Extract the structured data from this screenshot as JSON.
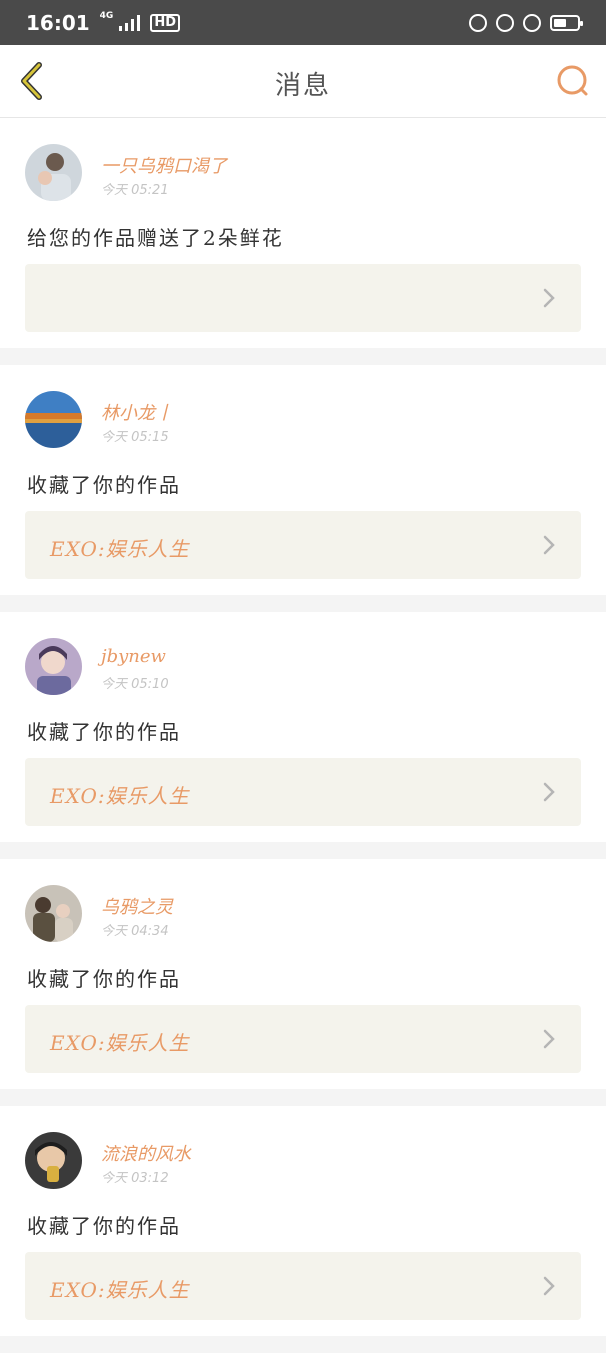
{
  "status_bar": {
    "time": "16:01",
    "network": "4G",
    "hd": "HD"
  },
  "nav": {
    "title": "消息",
    "back_icon": "chevron-left-icon",
    "search_icon": "search-icon",
    "accent": "#e89a66",
    "back_color": "#d6c43a"
  },
  "messages": [
    {
      "user": "一只乌鸦口渴了",
      "time": "今天 05:21",
      "action": "给您的作品赠送了2朵鲜花",
      "work": ""
    },
    {
      "user": "林小龙丨",
      "time": "今天 05:15",
      "action": "收藏了你的作品",
      "work": "EXO:娱乐人生"
    },
    {
      "user": "jbynew",
      "time": "今天 05:10",
      "action": "收藏了你的作品",
      "work": "EXO:娱乐人生"
    },
    {
      "user": "乌鸦之灵",
      "time": "今天 04:34",
      "action": "收藏了你的作品",
      "work": "EXO:娱乐人生"
    },
    {
      "user": "流浪的风水",
      "time": "今天 03:12",
      "action": "收藏了你的作品",
      "work": "EXO:娱乐人生"
    }
  ]
}
